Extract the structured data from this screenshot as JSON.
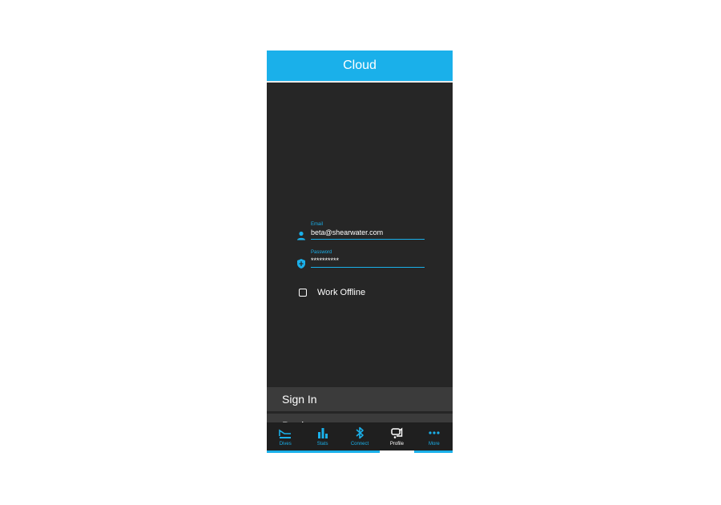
{
  "header": {
    "title": "Cloud"
  },
  "form": {
    "email": {
      "label": "Email",
      "value": "beta@shearwater.com",
      "icon": "person-icon"
    },
    "password": {
      "label": "Password",
      "value": "**********",
      "icon": "shield-icon"
    },
    "work_offline": {
      "label": "Work Offline",
      "checked": false
    }
  },
  "buttons": {
    "sign_in": "Sign In",
    "back": "Back"
  },
  "tabs": [
    {
      "label": "Dives",
      "icon": "dives-icon",
      "active": false
    },
    {
      "label": "Stats",
      "icon": "stats-icon",
      "active": false
    },
    {
      "label": "Connect",
      "icon": "bluetooth-icon",
      "active": false
    },
    {
      "label": "Profile",
      "icon": "profile-icon",
      "active": true
    },
    {
      "label": "More",
      "icon": "more-icon",
      "active": false
    }
  ],
  "colors": {
    "accent": "#1ab0ea",
    "background": "#262626",
    "button": "#3b3b3b"
  }
}
